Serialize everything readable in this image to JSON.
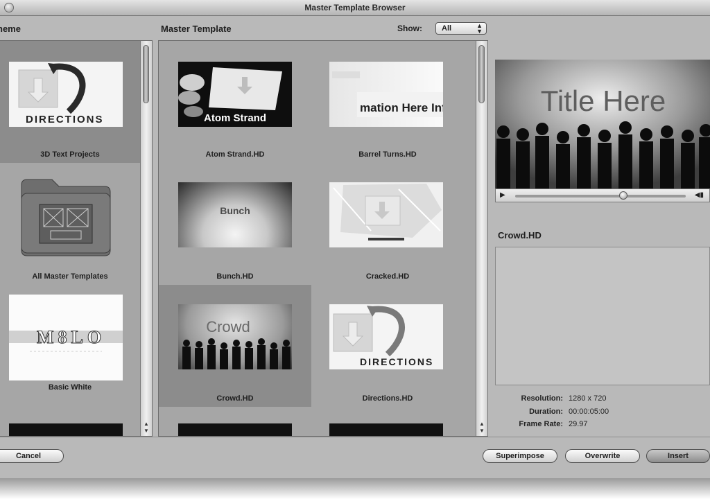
{
  "window": {
    "title": "Master Template Browser"
  },
  "theme_panel": {
    "header": "heme",
    "items": [
      {
        "label": "3D Text Projects",
        "selected": true,
        "art": "directions"
      },
      {
        "label": "All Master Templates",
        "selected": false,
        "art": "folder"
      },
      {
        "label": "Basic White",
        "selected": false,
        "art": "molo"
      }
    ]
  },
  "template_panel": {
    "header": "Master Template",
    "show_label": "Show:",
    "show_value": "All",
    "items": [
      {
        "label": "Atom Strand.HD",
        "art_text": "Atom Strand",
        "selected": false
      },
      {
        "label": "Barrel Turns.HD",
        "art_text": "mation Here Info",
        "selected": false
      },
      {
        "label": "Bunch.HD",
        "art_text": "Bunch",
        "selected": false
      },
      {
        "label": "Cracked.HD",
        "art_text": "",
        "selected": false
      },
      {
        "label": "Crowd.HD",
        "art_text": "Crowd",
        "selected": true
      },
      {
        "label": "Directions.HD",
        "art_text": "DIRECTIONS",
        "selected": false
      }
    ]
  },
  "art_text": {
    "directions": "DIRECTIONS",
    "molo": "M8LO"
  },
  "preview": {
    "title_text": "Title Here",
    "selected_name": "Crowd.HD",
    "resolution_label": "Resolution:",
    "resolution_value": "1280 x 720",
    "duration_label": "Duration:",
    "duration_value": "00:00:05:00",
    "framerate_label": "Frame Rate:",
    "framerate_value": "29.97"
  },
  "buttons": {
    "cancel": "Cancel",
    "superimpose": "Superimpose",
    "overwrite": "Overwrite",
    "insert": "Insert"
  }
}
